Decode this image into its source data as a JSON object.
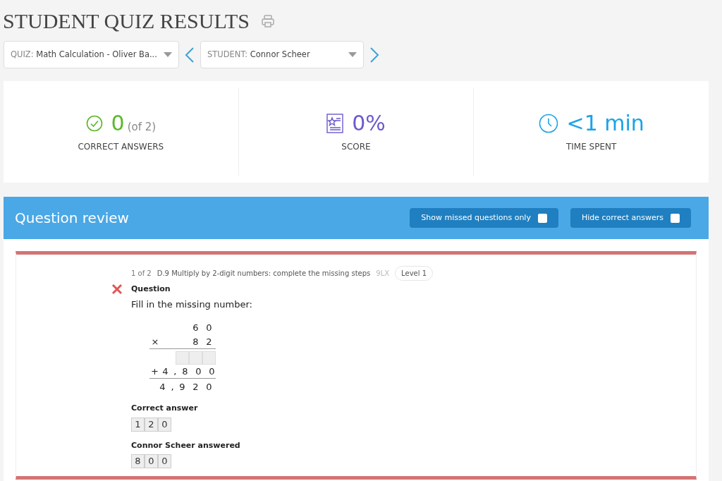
{
  "title": "STUDENT QUIZ RESULTS",
  "filters": [
    {
      "label": "QUIZ:",
      "value": "Math Calculation - Oliver Ba..."
    },
    {
      "label": "STUDENT:",
      "value": "Connor Scheer"
    }
  ],
  "stats": [
    {
      "kind": "correct",
      "value": "0",
      "extra": "(of 2)",
      "label": "CORRECT ANSWERS"
    },
    {
      "kind": "score",
      "value": "0%",
      "label": "SCORE"
    },
    {
      "kind": "time",
      "value": "<1 min",
      "label": "TIME SPENT"
    }
  ],
  "review": {
    "title": "Question review",
    "toggles": [
      {
        "label": "Show missed questions only",
        "checked": false
      },
      {
        "label": "Hide correct answers",
        "checked": false
      }
    ]
  },
  "question": {
    "position": "1 of 2",
    "skill": "D.9 Multiply by 2-digit numbers: complete the missing steps",
    "code": "9LX",
    "level": "Level 1",
    "correct": false,
    "heading": "Question",
    "prompt": "Fill in the missing number:",
    "rows": [
      {
        "operator": "",
        "rule_below": false,
        "cells": [
          {
            "kind": "digit",
            "text": "6"
          },
          {
            "kind": "digit",
            "text": "0"
          }
        ]
      },
      {
        "operator": "×",
        "rule_below": true,
        "cells": [
          {
            "kind": "digit",
            "text": "8"
          },
          {
            "kind": "digit",
            "text": "2"
          }
        ]
      },
      {
        "operator": "",
        "rule_below": false,
        "cells": [
          {
            "kind": "box"
          },
          {
            "kind": "box"
          },
          {
            "kind": "box"
          }
        ]
      },
      {
        "operator": "+",
        "rule_below": true,
        "cells": [
          {
            "kind": "digit",
            "text": "4"
          },
          {
            "kind": "comma",
            "text": ","
          },
          {
            "kind": "digit",
            "text": "8"
          },
          {
            "kind": "digit",
            "text": "0"
          },
          {
            "kind": "digit",
            "text": "0"
          }
        ]
      },
      {
        "operator": "",
        "rule_below": false,
        "cells": [
          {
            "kind": "digit",
            "text": "4"
          },
          {
            "kind": "comma",
            "text": ","
          },
          {
            "kind": "digit",
            "text": "9"
          },
          {
            "kind": "digit",
            "text": "2"
          },
          {
            "kind": "digit",
            "text": "0"
          }
        ]
      }
    ],
    "answers": [
      {
        "label": "Correct answer",
        "digits": [
          "1",
          "2",
          "0"
        ]
      },
      {
        "label": "Connor Scheer answered",
        "digits": [
          "8",
          "0",
          "0"
        ]
      }
    ]
  }
}
